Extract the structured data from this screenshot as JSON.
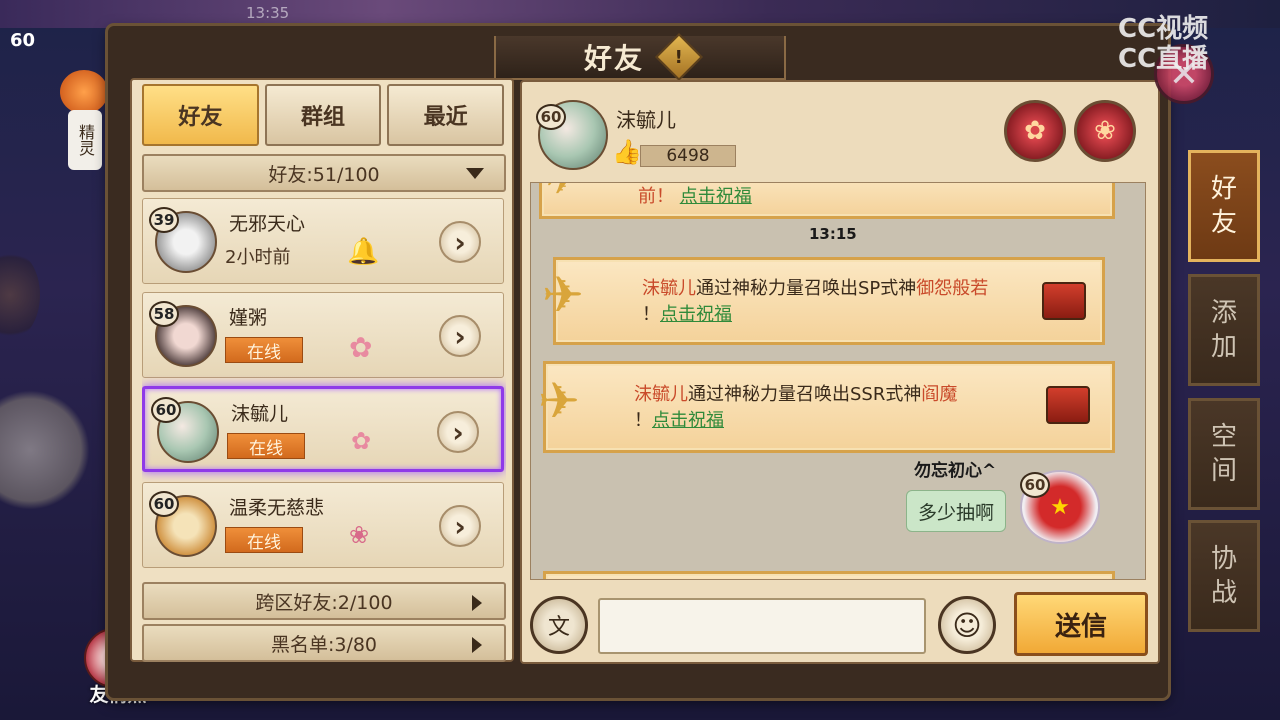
{
  "status_bar": {
    "time": "13:35"
  },
  "title": {
    "text": "好友",
    "help_glyph": "!"
  },
  "watermark": {
    "line1": "CC视频",
    "line2": "CC直播"
  },
  "tabs": [
    {
      "label": "好友",
      "active": true
    },
    {
      "label": "群组",
      "active": false
    },
    {
      "label": "最近",
      "active": false
    }
  ],
  "friend_count": "好友:51/100",
  "friends": [
    {
      "name": "无邪天心",
      "level": "39",
      "status": "2小时前",
      "online": false
    },
    {
      "name": "嫤粥",
      "level": "58",
      "status": "在线",
      "online": true
    },
    {
      "name": "沫毓儿",
      "level": "60",
      "status": "在线",
      "online": true,
      "selected": true
    },
    {
      "name": "温柔无慈悲",
      "level": "60",
      "status": "在线",
      "online": true
    }
  ],
  "cross_server": "跨区好友:2/100",
  "blacklist": "黑名单:3/80",
  "chat": {
    "partner_name": "沫毓儿",
    "partner_level": "60",
    "likes": "6498",
    "top_fragment": {
      "text": "前！",
      "link": "点击祝福"
    },
    "timestamp": "13:15",
    "messages": [
      {
        "who": "沫毓儿",
        "mid": "通过神秘力量召唤出SP式神",
        "shikigami": "御怨般若",
        "end": "！",
        "link": "点击祝福"
      },
      {
        "who": "沫毓儿",
        "mid": "通过神秘力量召唤出SSR式神",
        "shikigami": "阎魔",
        "end": "！",
        "link": "点击祝福"
      }
    ],
    "sender_name": "勿忘初心^",
    "sender_level": "60",
    "sender_message": "多少抽啊",
    "input_placeholder": "",
    "voice_glyph": "文",
    "emoji_glyph": "☺",
    "send_label": "送信"
  },
  "side_tabs": [
    {
      "line1": "好",
      "line2": "友",
      "active": true
    },
    {
      "line1": "添",
      "line2": "加",
      "active": false
    },
    {
      "line1": "空",
      "line2": "间",
      "active": false
    },
    {
      "line1": "协",
      "line2": "战",
      "active": false
    }
  ],
  "spirit": {
    "label": "精灵",
    "level": "60"
  },
  "friendship_points": "友情点",
  "icons": {
    "arrow": "›",
    "close": "✕",
    "like": "👍"
  },
  "colors": {
    "accent": "#f1b94b",
    "online": "#d26a1d",
    "selected": "#8f3ae8",
    "link": "#2f8a3a"
  }
}
